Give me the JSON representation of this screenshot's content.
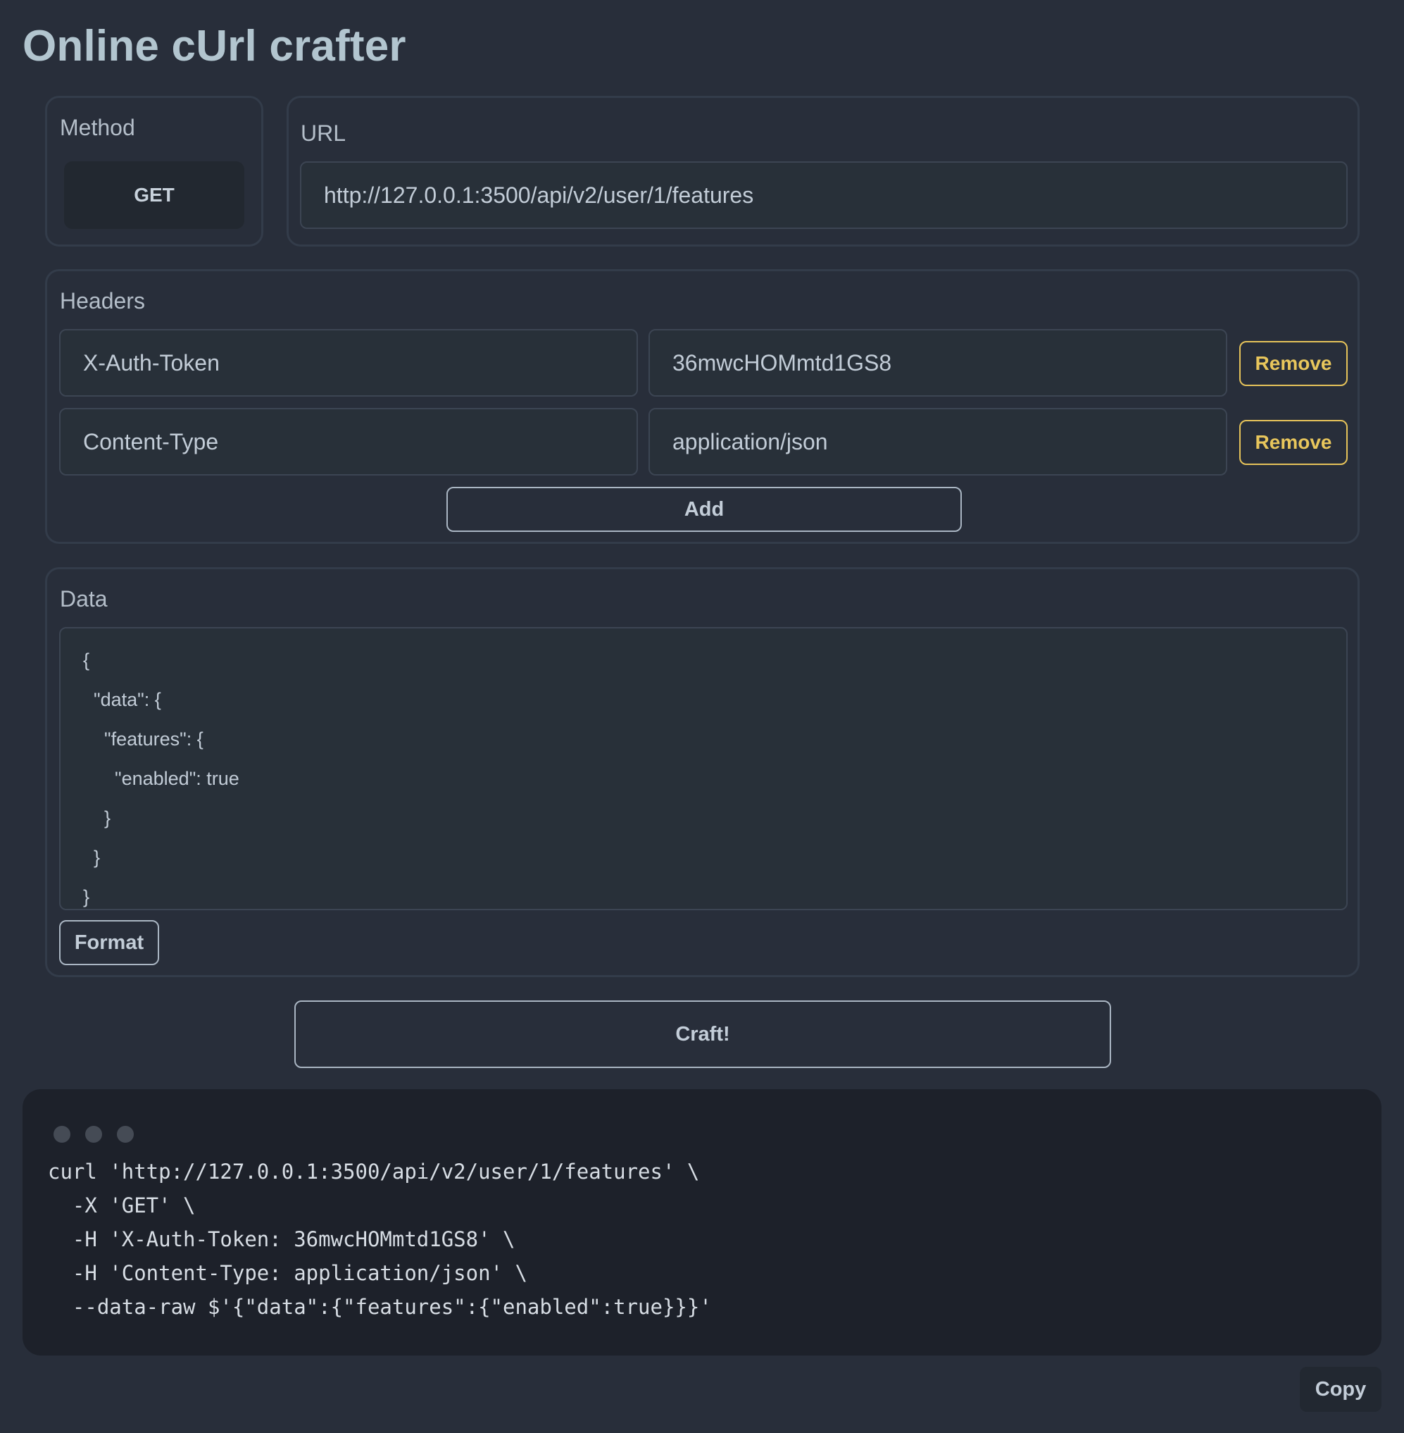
{
  "page": {
    "title": "Online cUrl crafter"
  },
  "method": {
    "legend": "Method",
    "value": "GET"
  },
  "url": {
    "legend": "URL",
    "value": "http://127.0.0.1:3500/api/v2/user/1/features"
  },
  "headers": {
    "legend": "Headers",
    "rows": [
      {
        "key": "X-Auth-Token",
        "value": "36mwcHOMmtd1GS8",
        "remove_label": "Remove"
      },
      {
        "key": "Content-Type",
        "value": "application/json",
        "remove_label": "Remove"
      }
    ],
    "add_label": "Add"
  },
  "data": {
    "legend": "Data",
    "lines": [
      "{",
      "  \"data\": {",
      "    \"features\": {",
      "      \"enabled\": true",
      "    }",
      "  }",
      "}"
    ],
    "format_label": "Format"
  },
  "craft": {
    "label": "Craft!"
  },
  "output": {
    "lines": [
      "curl 'http://127.0.0.1:3500/api/v2/user/1/features' \\",
      "  -X 'GET' \\",
      "  -H 'X-Auth-Token: 36mwcHOMmtd1GS8' \\",
      "  -H 'Content-Type: application/json' \\",
      "  --data-raw $'{\"data\":{\"features\":{\"enabled\":true}}}'"
    ],
    "copy_label": "Copy"
  }
}
